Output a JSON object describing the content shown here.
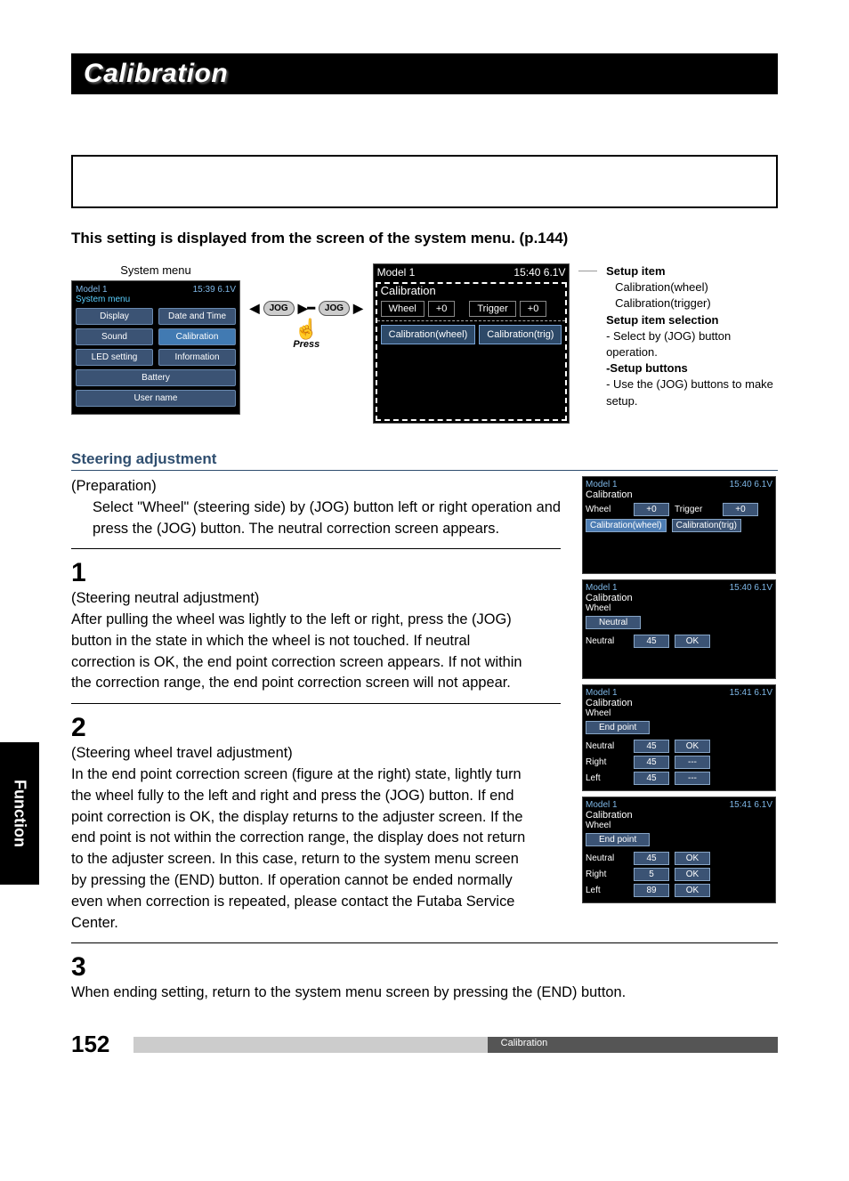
{
  "title": "Calibration",
  "subhead": "This setting is displayed from the screen of the system menu. (p.144)",
  "sysmenu_label": "System menu",
  "sysmenu_title": "System menu",
  "sysmenu_items": [
    [
      "Display",
      "Date and Time"
    ],
    [
      "Sound",
      "Calibration"
    ],
    [
      "LED setting",
      "Information"
    ],
    [
      "Battery",
      ""
    ],
    [
      "User name",
      ""
    ]
  ],
  "jog": "JOG",
  "press": "Press",
  "cal_screen": {
    "model": "Model 1",
    "time": "15:40 6.1V",
    "title": "Calibration",
    "wheel": "Wheel",
    "wheel_val": "+0",
    "trigger": "Trigger",
    "trigger_val": "+0",
    "btn_wheel": "Calibration(wheel)",
    "btn_trig": "Calibration(trig)"
  },
  "setup": {
    "item_lbl": "Setup item",
    "item1": "Calibration(wheel)",
    "item2": "Calibration(trigger)",
    "sel_lbl": "Setup item selection",
    "sel_txt": "- Select by (JOG) button operation.",
    "btn_lbl": "-Setup buttons",
    "btn_txt": "- Use the (JOG) buttons to make setup."
  },
  "steering_hdr": "Steering adjustment",
  "prep_lbl": "(Preparation)",
  "prep_txt": "Select \"Wheel\" (steering side) by (JOG) button left or right operation and press the (JOG) button. The neutral correction screen appears.",
  "step1_lbl": "(Steering neutral adjustment)",
  "step1_txt": "After pulling the wheel was lightly to the left or right, press the (JOG) button in the state in which the wheel is not touched. If neutral correction is OK, the end point correction screen appears. If not within the correction range, the end point correction screen will not appear.",
  "step2_lbl": "(Steering wheel travel adjustment)",
  "step2_txt": "In the end point correction screen (figure at the right) state, lightly turn the wheel fully to the left and right and press the (JOG) button. If end point correction is OK, the display returns to the adjuster screen. If the end point is not within the correction range, the display does not return to the adjuster screen. In this case, return to the system menu screen by pressing the (END) button. If operation cannot be ended normally even when correction is repeated, please contact the Futaba Service Center.",
  "step3_txt": "When ending setting, return to the system menu screen by pressing the (END) button.",
  "mini1": {
    "model": "Model 1",
    "time": "15:40 6.1V",
    "title": "Calibration",
    "wheel": "Wheel",
    "wval": "+0",
    "trigger": "Trigger",
    "tval": "+0",
    "b1": "Calibration(wheel)",
    "b2": "Calibration(trig)"
  },
  "mini2": {
    "model": "Model 1",
    "time": "15:40 6.1V",
    "title": "Calibration",
    "sub": "Wheel",
    "badge": "Neutral",
    "r1": [
      "Neutral",
      "45",
      "OK"
    ]
  },
  "mini3": {
    "model": "Model 1",
    "time": "15:41 6.1V",
    "title": "Calibration",
    "sub": "Wheel",
    "badge": "End point",
    "r1": [
      "Neutral",
      "45",
      "OK"
    ],
    "r2": [
      "Right",
      "45",
      "---"
    ],
    "r3": [
      "Left",
      "45",
      "---"
    ]
  },
  "mini4": {
    "model": "Model 1",
    "time": "15:41 6.1V",
    "title": "Calibration",
    "sub": "Wheel",
    "badge": "End point",
    "r1": [
      "Neutral",
      "45",
      "OK"
    ],
    "r2": [
      "Right",
      "5",
      "OK"
    ],
    "r3": [
      "Left",
      "89",
      "OK"
    ]
  },
  "page_num": "152",
  "footer_label": "Calibration",
  "side_tab": "Function"
}
